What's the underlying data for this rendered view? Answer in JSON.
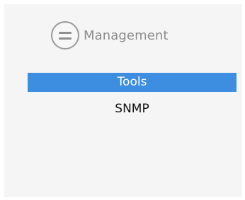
{
  "header": {
    "icon": "menu-lines-icon",
    "title": "Management"
  },
  "menu": {
    "items": [
      {
        "label": "Tools",
        "active": true
      },
      {
        "label": "SNMP",
        "active": false
      }
    ]
  },
  "colors": {
    "active_bg": "#3d8de1",
    "active_text": "#ffffff",
    "text": "#111111",
    "panel_bg": "#f5f5f5",
    "icon_gray": "#9a9a9a"
  }
}
